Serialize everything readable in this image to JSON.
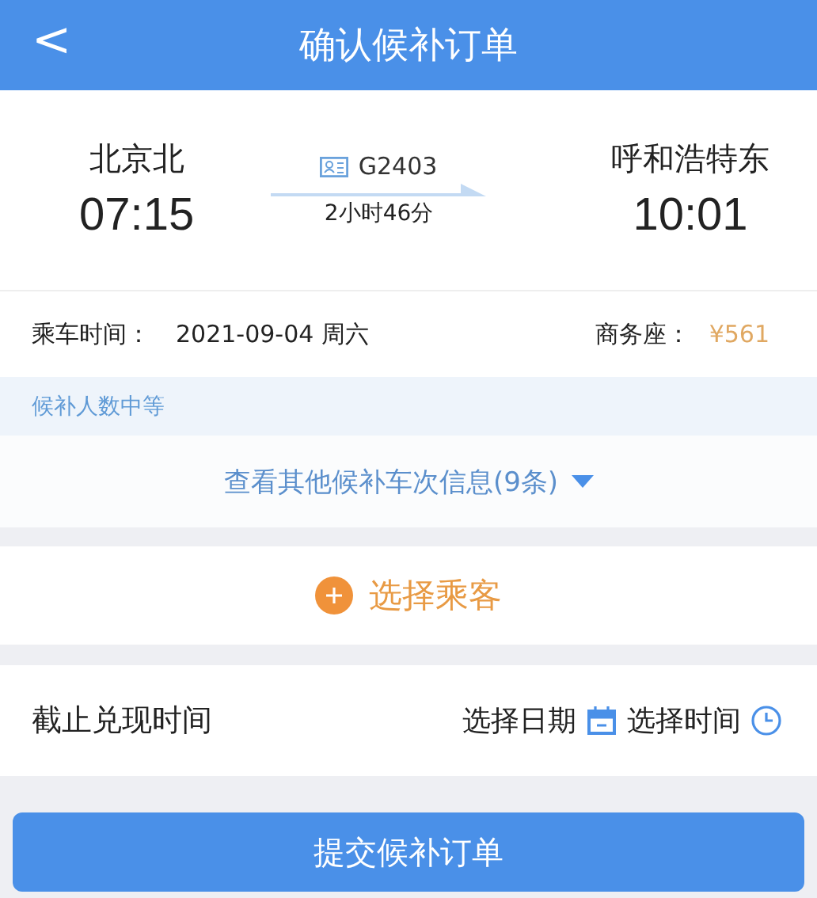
{
  "header": {
    "back": "<",
    "title": "确认候补订单"
  },
  "train": {
    "from_station": "北京北",
    "depart_time": "07:15",
    "number": "G2403",
    "duration": "2小时46分",
    "to_station": "呼和浩特东",
    "arrive_time": "10:01"
  },
  "trip": {
    "date_label": "乘车时间：",
    "date": "2021-09-04 周六",
    "seat_label": "商务座：",
    "price": "¥561"
  },
  "queue_status": "候补人数中等",
  "other_trains_link": "查看其他候补车次信息(9条)",
  "add_passenger": "选择乘客",
  "deadline": {
    "label": "截止兑现时间",
    "date_placeholder": "选择日期",
    "time_placeholder": "选择时间"
  },
  "submit": "提交候补订单"
}
